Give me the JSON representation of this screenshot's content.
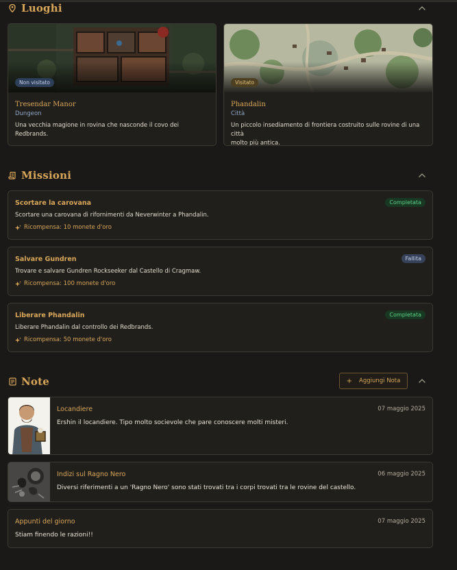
{
  "locations": {
    "title": "Luoghi",
    "items": [
      {
        "name": "Tresendar Manor",
        "type": "Dungeon",
        "badge": "Non visitato",
        "description": "Una vecchia magione in rovina che nasconde il covo dei Redbrands."
      },
      {
        "name": "Phandalin",
        "type": "Città",
        "badge": "Visitato",
        "description_line1": "Un piccolo insediamento di frontiera costruito sulle rovine di una città",
        "description_line2": "molto più antica."
      }
    ]
  },
  "missions": {
    "title": "Missioni",
    "items": [
      {
        "title": "Scortare la carovana",
        "description": "Scortare una carovana di rifornimenti da Neverwinter a Phandalin.",
        "reward": "Ricompensa: 10 monete d'oro",
        "status": "Completata"
      },
      {
        "title": "Salvare Gundren",
        "description": "Trovare e salvare Gundren Rockseeker dal Castello di Cragmaw.",
        "reward": "Ricompensa: 100 monete d'oro",
        "status": "Fallita"
      },
      {
        "title": "Liberare Phandalin",
        "description": "Liberare Phandalin dal controllo dei Redbrands.",
        "reward": "Ricompensa: 50 monete d'oro",
        "status": "Completata"
      }
    ]
  },
  "notes": {
    "title": "Note",
    "add_button": "Aggiungi Nota",
    "items": [
      {
        "title": "Locandiere",
        "date": "07 maggio 2025",
        "body": "Ershin il locandiere. Tipo molto socievole che pare conoscere molti misteri."
      },
      {
        "title": "Indizi sul Ragno Nero",
        "date": "06 maggio 2025",
        "body": "Diversi riferimenti a un 'Ragno Nero' sono stati trovati tra i corpi trovati tra le rovine del castello."
      },
      {
        "title": "Appunti del giorno",
        "date": "07 maggio 2025",
        "body": "Stiam finendo le razioni!!"
      }
    ]
  },
  "colors": {
    "accent": "#d9a75a",
    "background": "#1a1917",
    "card": "#211f1b",
    "status_completed": "#5fcf84",
    "status_failed": "#c4d0e6"
  },
  "icons": {
    "locations": "map-pin-icon",
    "missions": "scroll-icon",
    "notes": "notebook-icon",
    "collapse": "chevron-up-icon",
    "reward": "sparkle-icon",
    "add": "plus-icon"
  }
}
